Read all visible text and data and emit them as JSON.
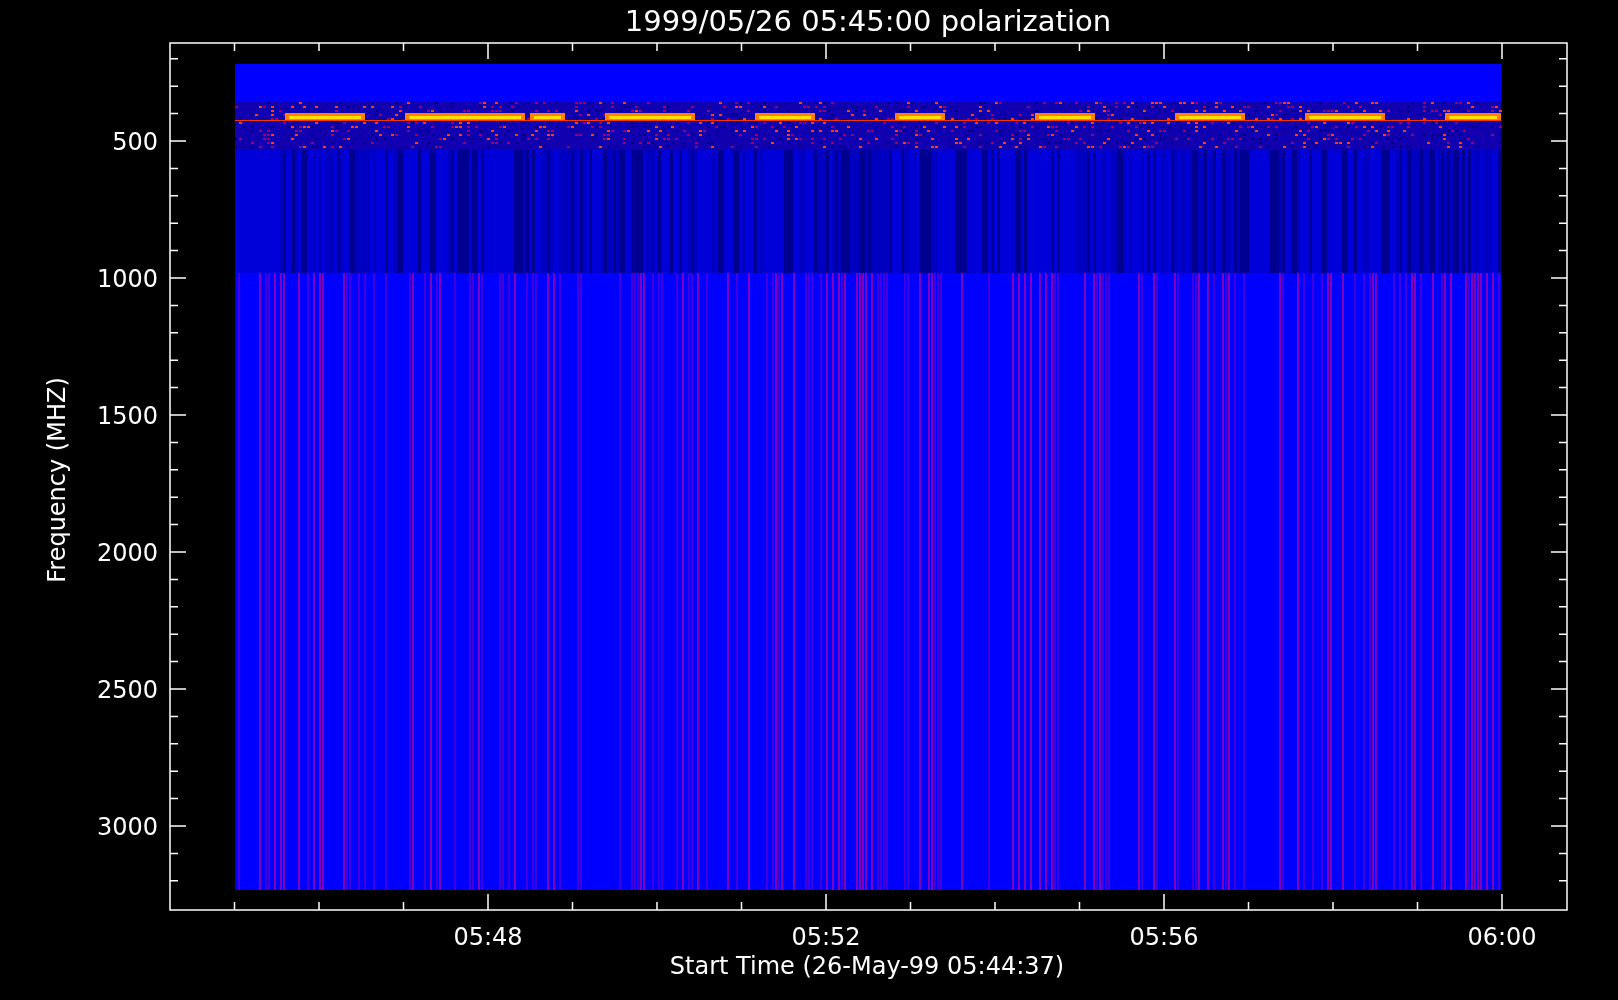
{
  "title": "1999/05/26 05:45:00 polarization",
  "y_axis": {
    "label": "Frequency (MHZ)",
    "ticks": [
      "500",
      "1000",
      "1500",
      "2000",
      "2500",
      "3000"
    ]
  },
  "x_axis": {
    "label": "Start Time (26-May-99 05:44:37)",
    "ticks": [
      "05:48",
      "05:52",
      "05:56",
      "06:00"
    ]
  }
}
